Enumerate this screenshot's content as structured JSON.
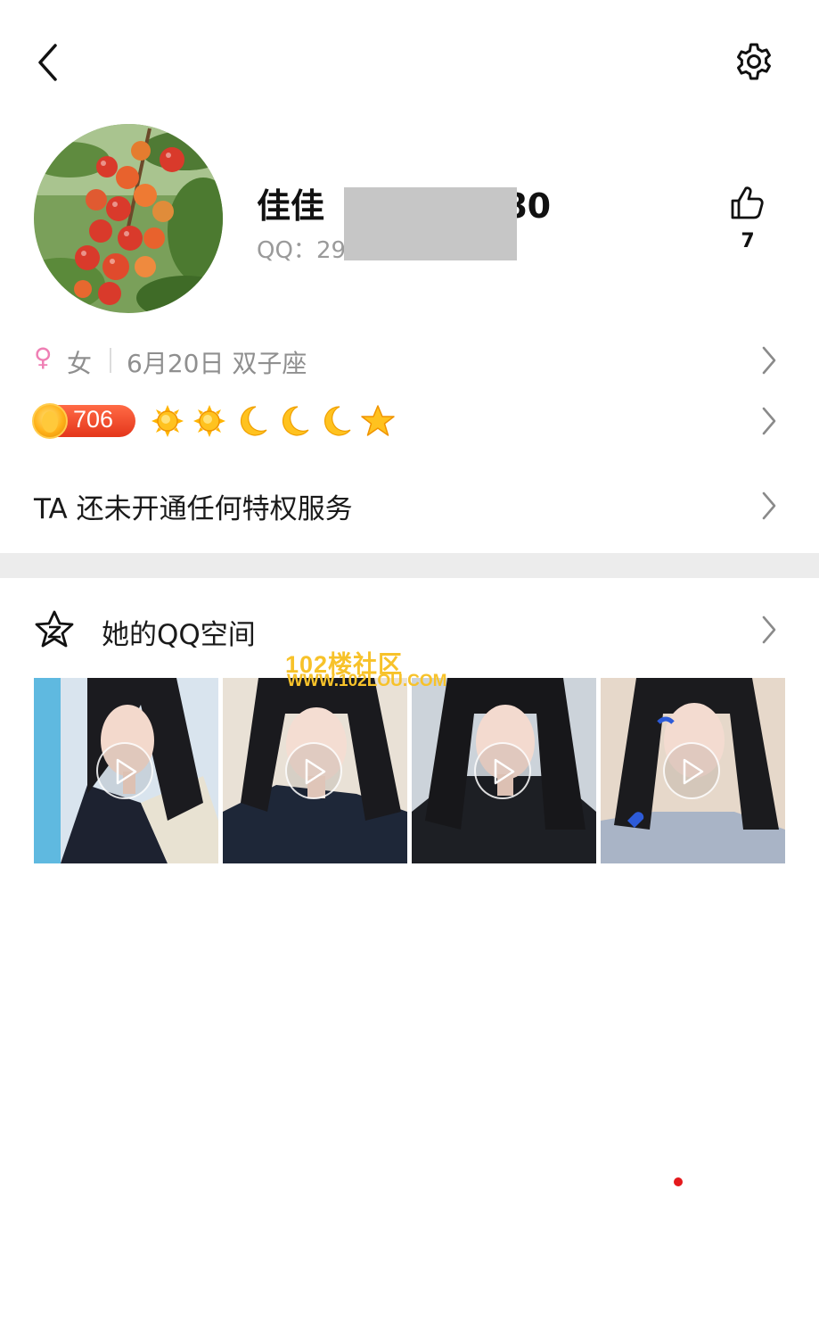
{
  "profile": {
    "name_visible_start": "佳佳 ",
    "name_visible_end": "80",
    "qq_label": "QQ：",
    "qq_visible_start": "29",
    "likes": "7"
  },
  "info": {
    "gender_symbol": "♀",
    "gender": "女",
    "birthday": "6月20日 双子座"
  },
  "level": {
    "value": "706",
    "icons": [
      "sun-icon",
      "sun-icon",
      "moon-icon",
      "moon-icon",
      "moon-icon",
      "star-icon"
    ]
  },
  "privilege": {
    "text": "TA 还未开通任何特权服务"
  },
  "qzone": {
    "label": "她的QQ空间",
    "videos": 4
  },
  "watermark": {
    "line1": "102楼社区",
    "line2": "WWW.102LOU.COM"
  },
  "colors": {
    "gender_pink": "#ef7fb4",
    "badge_red": "#e4361b",
    "watermark_yellow": "#f7c22a",
    "notification_red": "#e4191c"
  }
}
